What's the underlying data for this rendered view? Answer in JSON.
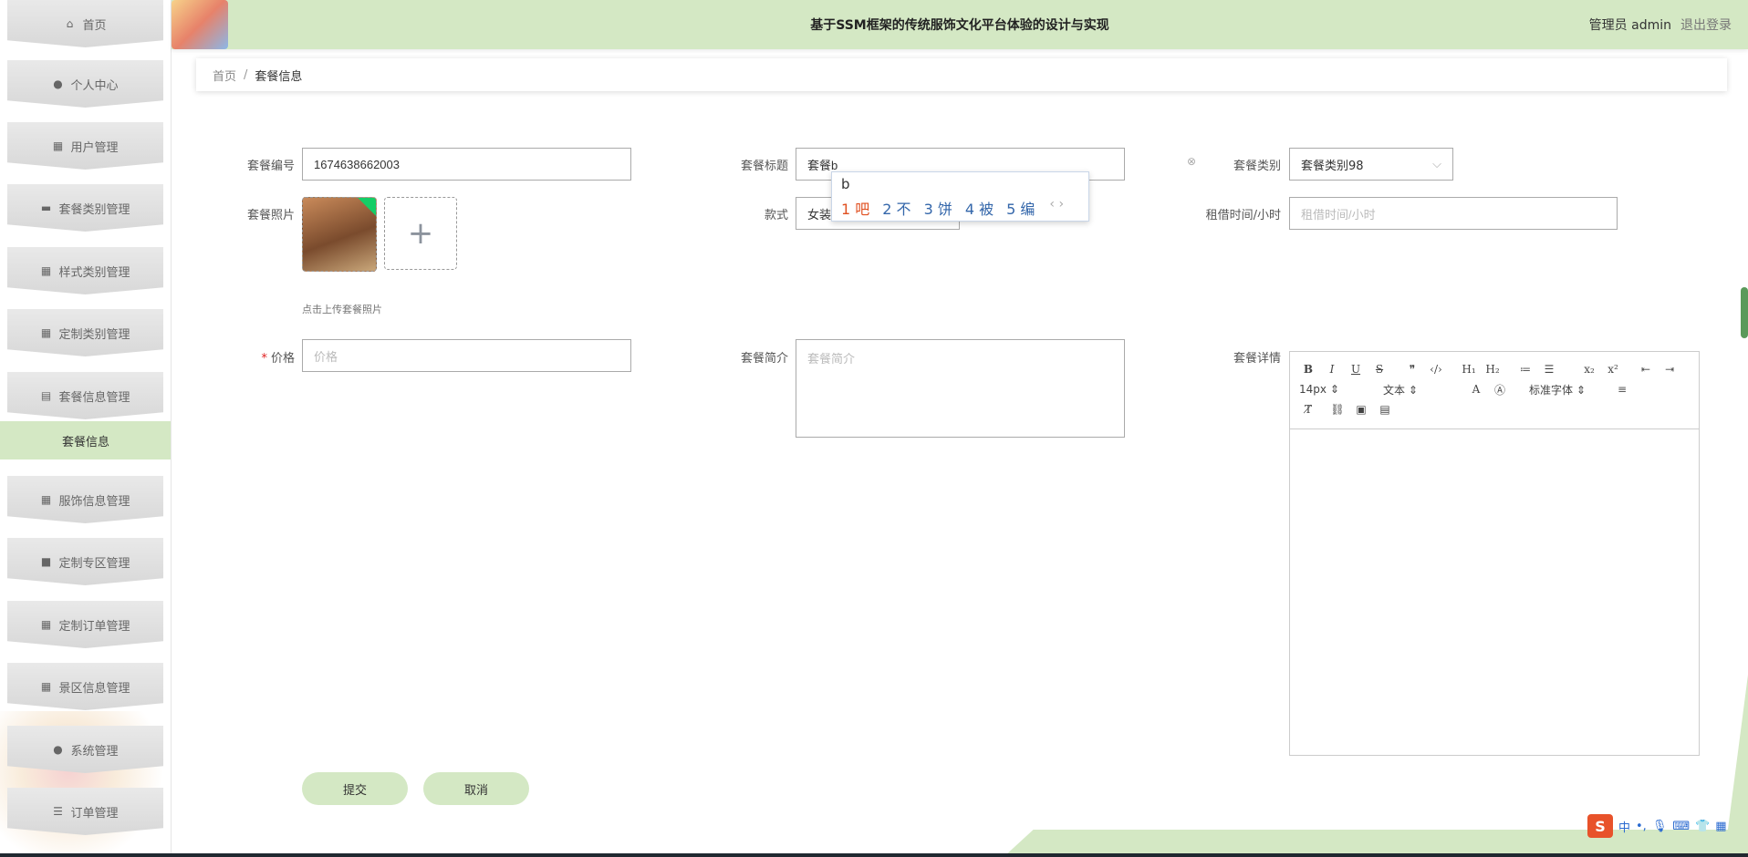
{
  "header": {
    "title": "基于SSM框架的传统服饰文化平台体验的设计与实现",
    "user": "管理员 admin",
    "logout": "退出登录"
  },
  "sidebar": {
    "items": [
      {
        "label": "首页",
        "icon": "home-icon"
      },
      {
        "label": "个人中心",
        "icon": "user-icon"
      },
      {
        "label": "用户管理",
        "icon": "grid-icon"
      },
      {
        "label": "套餐类别管理",
        "icon": "briefcase-icon"
      },
      {
        "label": "样式类别管理",
        "icon": "grid-icon"
      },
      {
        "label": "定制类别管理",
        "icon": "grid-icon"
      },
      {
        "label": "套餐信息管理",
        "icon": "clipboard-icon"
      },
      {
        "label": "服饰信息管理",
        "icon": "grid-icon"
      },
      {
        "label": "定制专区管理",
        "icon": "monitor-icon"
      },
      {
        "label": "定制订单管理",
        "icon": "grid-icon"
      },
      {
        "label": "景区信息管理",
        "icon": "grid-icon"
      },
      {
        "label": "系统管理",
        "icon": "pin-icon"
      },
      {
        "label": "订单管理",
        "icon": "list-icon"
      }
    ],
    "active_sub": "套餐信息"
  },
  "breadcrumb": {
    "home": "首页",
    "sep": "/",
    "current": "套餐信息"
  },
  "form": {
    "code_label": "套餐编号",
    "code_value": "1674638662003",
    "title_label": "套餐标题",
    "title_value": "套餐b",
    "category_label": "套餐类别",
    "category_value": "套餐类别98",
    "photo_label": "套餐照片",
    "photo_hint": "点击上传套餐照片",
    "style_label": "款式",
    "style_value": "女装",
    "rent_label": "租借时间/小时",
    "rent_placeholder": "租借时间/小时",
    "price_label": "价格",
    "price_placeholder": "价格",
    "intro_label": "套餐简介",
    "intro_placeholder": "套餐简介",
    "detail_label": "套餐详情",
    "submit": "提交",
    "cancel": "取消"
  },
  "editor": {
    "font_size": "14px",
    "text_type": "文本",
    "font_family": "标准字体"
  },
  "ime": {
    "composition": "b",
    "candidates": [
      "1 吧",
      "2 不",
      "3 饼",
      "4 被",
      "5 编"
    ]
  },
  "tray": {
    "lang": "中"
  },
  "colors": {
    "accent": "#d4e8c4",
    "required": "#e02020"
  }
}
